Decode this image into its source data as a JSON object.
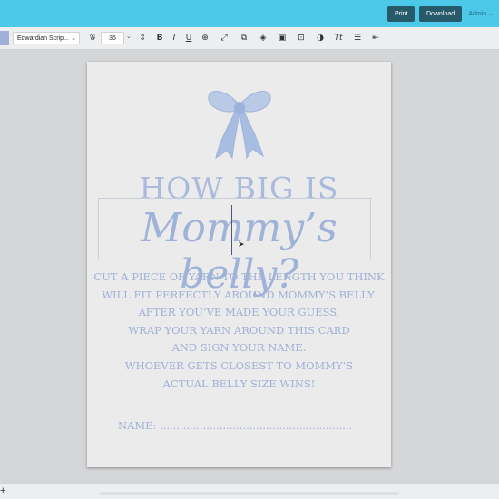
{
  "topbar": {
    "print_label": "Print",
    "download_label": "Download",
    "admin_label": "Admin ⌄",
    "accent_color": "#4cc9e8"
  },
  "toolbar": {
    "font_name": "Edwardian Scrip...",
    "font_size": "35",
    "tools": [
      "font-style-icon",
      "text-height-icon",
      "bold-icon",
      "italic-icon",
      "underline-icon",
      "strikethrough-icon",
      "resize-icon",
      "duplicate-icon",
      "layers-icon",
      "lock-icon",
      "lock-alt-icon",
      "color-icon",
      "text-style-icon",
      "line-spacing-icon",
      "align-icon"
    ]
  },
  "card": {
    "heading_line1": "HOW BIG IS",
    "heading_line2": "Mommy’s belly?",
    "instructions": [
      "CUT A PIECE OF YARN TO THE LENGTH YOU THINK",
      "WILL FIT PERFECTLY AROUND MOMMY’S BELLY.",
      "AFTER YOU’VE MADE YOUR GUESS,",
      "WRAP YOUR YARN AROUND THIS CARD",
      "AND SIGN YOUR NAME.",
      "WHOEVER GETS CLOSEST TO MOMMY’S",
      "ACTUAL BELLY SIZE WINS!"
    ],
    "name_label": "NAME: ..........................................................",
    "text_color": "#9fb1d6"
  },
  "bottombar": {
    "add_label": "+"
  }
}
